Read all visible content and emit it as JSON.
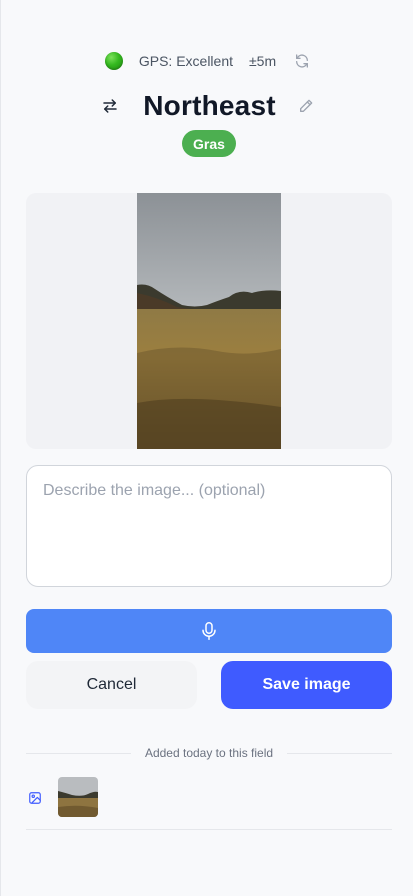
{
  "gps": {
    "status": "GPS: Excellent",
    "accuracy": "±5m",
    "indicator_color": "#34b81f",
    "indicator_icon": "green-dot-icon",
    "refresh_icon": "refresh-icon"
  },
  "heading": {
    "direction": "Northeast",
    "swap_icon": "swap-arrows-icon",
    "edit_icon": "pencil-icon"
  },
  "badge": {
    "label": "Gras",
    "color": "#4caf50"
  },
  "description": {
    "value": "",
    "placeholder": "Describe the image... (optional)"
  },
  "buttons": {
    "mic_icon": "microphone-icon",
    "mic_color": "#4f86f7",
    "cancel_label": "Cancel",
    "save_label": "Save image",
    "save_color": "#3f5bff"
  },
  "history": {
    "divider_label": "Added today to this field",
    "items": [
      {
        "icon": "image-icon"
      }
    ]
  }
}
